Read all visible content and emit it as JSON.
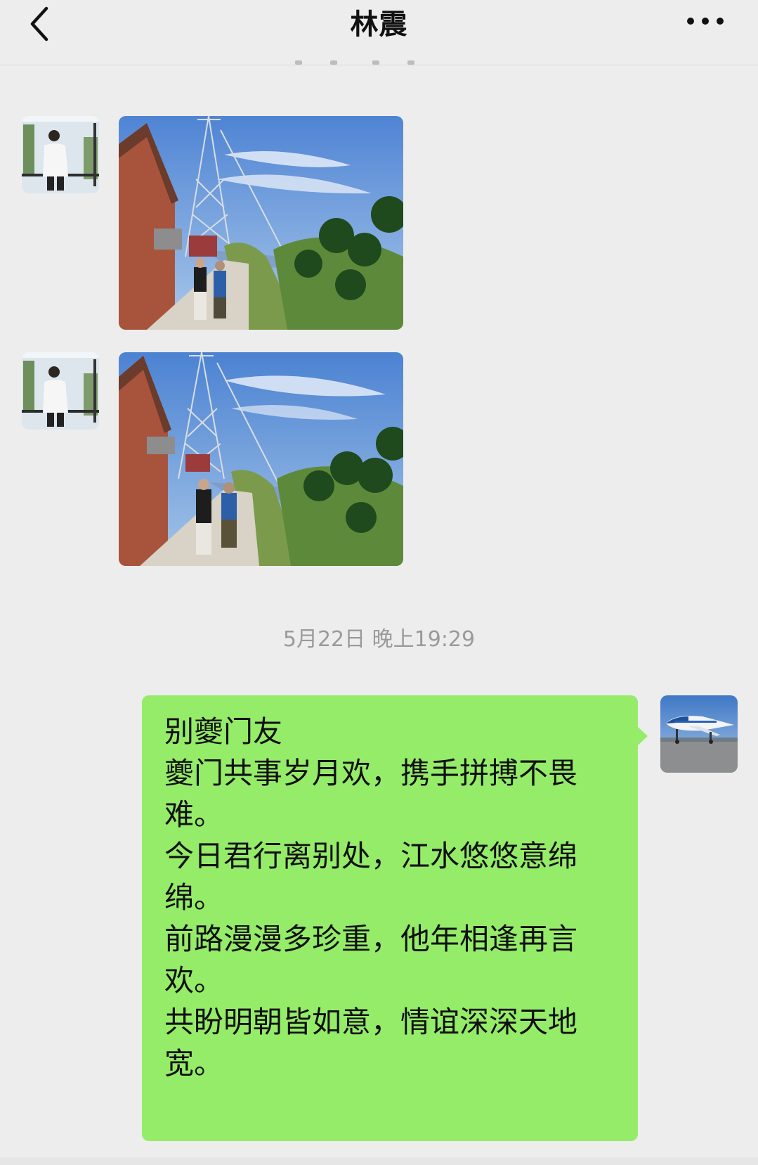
{
  "header": {
    "title": "林震",
    "back_icon": "chevron-left-icon",
    "more_icon": "more-dots-icon"
  },
  "messages": [
    {
      "sender": "contact",
      "type": "image",
      "avatar": "contact-avatar",
      "content": "photo-power-tower-road"
    },
    {
      "sender": "contact",
      "type": "image",
      "avatar": "contact-avatar",
      "content": "photo-power-tower-road"
    }
  ],
  "timestamp": "5月22日 晚上19:29",
  "outgoing": {
    "avatar": "airplane-avatar",
    "lines": [
      "别夔门友",
      "",
      "夔门共事岁月欢，携手拼搏不畏",
      "难。",
      "今日君行离别处，江水悠悠意绵",
      "绵。",
      "前路漫漫多珍重，他年相逢再言",
      "欢。",
      "共盼明朝皆如意，情谊深深天地",
      "宽。"
    ]
  },
  "colors": {
    "background": "#ededed",
    "outgoing_bubble": "#95ec69",
    "timestamp_text": "#9a9a9a"
  }
}
